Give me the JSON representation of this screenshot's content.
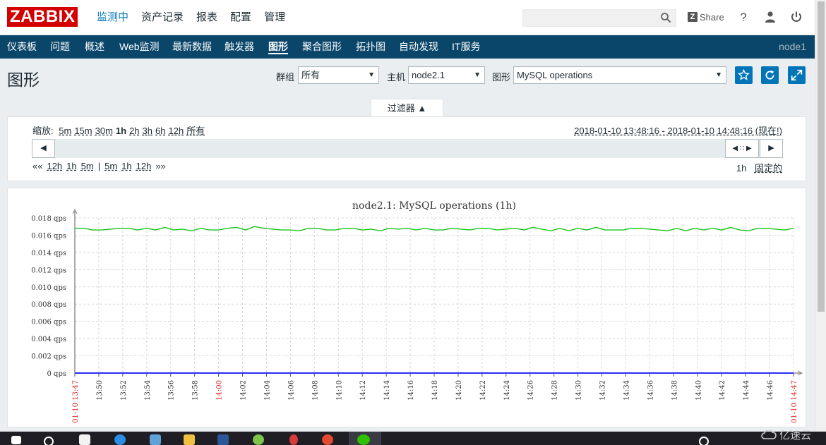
{
  "logo": "ZABBIX",
  "main_menu": [
    "监测中",
    "资产记录",
    "报表",
    "配置",
    "管理"
  ],
  "share_label": "Share",
  "help_label": "?",
  "sub_menu": [
    "仪表板",
    "问题",
    "概述",
    "Web监测",
    "最新数据",
    "触发器",
    "图形",
    "聚合图形",
    "拓扑图",
    "自动发现",
    "IT服务"
  ],
  "server_name": "node1",
  "page_title": "图形",
  "filters": {
    "group_label": "群组",
    "group_value": "所有",
    "host_label": "主机",
    "host_value": "node2.1",
    "graph_label": "图形",
    "graph_value": "MySQL operations"
  },
  "filter_tab": "过滤器 ▲",
  "zoom": {
    "label": "缩放:",
    "options": [
      "5m",
      "15m",
      "30m",
      "1h",
      "2h",
      "3h",
      "6h",
      "12h",
      "所有"
    ],
    "current": "1h"
  },
  "time_range": "2018-01-10 13:48:16 - 2018-01-10 14:48:16 (现在!)",
  "nav": {
    "back_fast": "««",
    "back": [
      "12h",
      "1h",
      "5m"
    ],
    "sep": "|",
    "fwd": [
      "5m",
      "1h",
      "12h"
    ],
    "fwd_fast": "»»"
  },
  "period": "1h",
  "fixed_label": "固定的",
  "watermark": "亿速云",
  "chart_data": {
    "type": "line",
    "title": "node2.1: MySQL operations (1h)",
    "y_unit": "qps",
    "y_ticks": [
      "0 qps",
      "0.002 qps",
      "0.004 qps",
      "0.006 qps",
      "0.008 qps",
      "0.010 qps",
      "0.012 qps",
      "0.014 qps",
      "0.016 qps",
      "0.018 qps"
    ],
    "ylim": [
      0,
      0.018
    ],
    "x_ticks": [
      "01-10 13:47",
      "13:50",
      "13:52",
      "13:54",
      "13:56",
      "13:58",
      "14:00",
      "14:02",
      "14:04",
      "14:06",
      "14:08",
      "14:10",
      "14:12",
      "14:14",
      "14:16",
      "14:18",
      "14:20",
      "14:22",
      "14:24",
      "14:26",
      "14:28",
      "14:30",
      "14:32",
      "14:34",
      "14:36",
      "14:38",
      "14:40",
      "14:42",
      "14:44",
      "14:46",
      "01-10 14:47"
    ],
    "x_ticks_red": [
      "01-10 13:47",
      "14:00",
      "01-10 14:47"
    ],
    "series": [
      {
        "color": "#19c419",
        "values": [
          0.0168,
          0.0168,
          0.0166,
          0.0166,
          0.0167,
          0.0168,
          0.0168,
          0.0166,
          0.0168,
          0.0166,
          0.0169,
          0.0166,
          0.0167,
          0.0165,
          0.0168,
          0.0166,
          0.0166,
          0.0168,
          0.0169,
          0.0166,
          0.017,
          0.0168,
          0.0167,
          0.0166,
          0.0166,
          0.0165,
          0.0168,
          0.0168,
          0.0166,
          0.0166,
          0.0168,
          0.0168,
          0.0166,
          0.0167,
          0.0165,
          0.0168,
          0.0167,
          0.0168,
          0.0166,
          0.0168,
          0.0166,
          0.0166,
          0.0168,
          0.0167,
          0.0166,
          0.0168,
          0.0168,
          0.0166,
          0.0167,
          0.0168,
          0.0166,
          0.0169,
          0.0167,
          0.0165,
          0.0168,
          0.0165,
          0.0168,
          0.0166,
          0.0169,
          0.0166,
          0.0166,
          0.0166,
          0.0168,
          0.0168,
          0.0167,
          0.0166,
          0.0165,
          0.0168,
          0.0165,
          0.0168,
          0.0166,
          0.0168,
          0.0166,
          0.0169,
          0.0166,
          0.0165,
          0.0168,
          0.0168,
          0.0167,
          0.0166,
          0.0168
        ]
      },
      {
        "color": "#b43cc8",
        "values": [
          0,
          0
        ]
      },
      {
        "color": "#2c2cff",
        "values": [
          0,
          0
        ]
      }
    ]
  }
}
